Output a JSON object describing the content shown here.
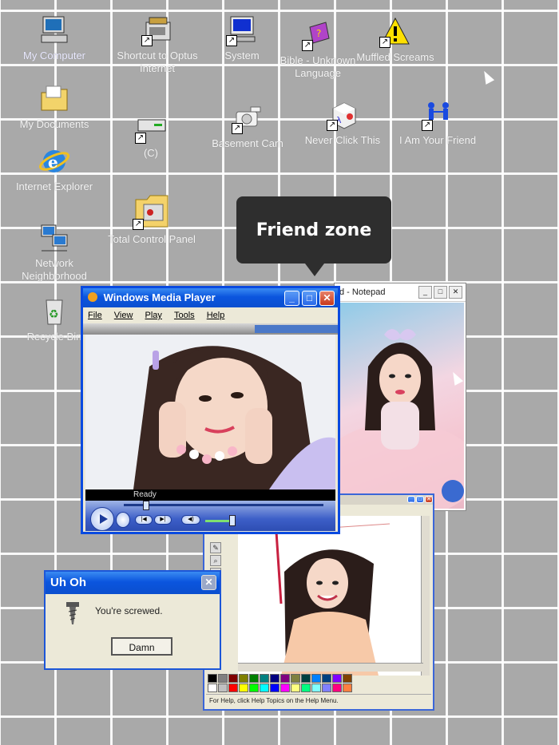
{
  "desktop": {
    "icons": [
      {
        "label": "My Computer",
        "icon": "computer-icon"
      },
      {
        "label": "Shortcut to Optus Internet",
        "icon": "phone-icon"
      },
      {
        "label": "System",
        "icon": "monitor-icon"
      },
      {
        "label": "Bible - Unknown Language",
        "icon": "book-icon"
      },
      {
        "label": "Muffled Screams",
        "icon": "warning-icon"
      },
      {
        "label": "My Documents",
        "icon": "folder-icon"
      },
      {
        "label": "(C)",
        "icon": "drive-icon"
      },
      {
        "label": "Basement Cam",
        "icon": "camera-icon"
      },
      {
        "label": "Never Click This",
        "icon": "cube-icon"
      },
      {
        "label": "I Am Your Friend",
        "icon": "people-icon"
      },
      {
        "label": "Internet Explorer",
        "icon": "ie-icon"
      },
      {
        "label": "Total Control Panel",
        "icon": "control-panel-icon"
      },
      {
        "label": "Network Neighborhood",
        "icon": "network-icon"
      },
      {
        "label": "Recycle Bin",
        "icon": "recycle-icon"
      }
    ],
    "tooltip": "Friend zone"
  },
  "notepad": {
    "title": "d - Notepad"
  },
  "wmp": {
    "title": "Windows Media Player",
    "menu": [
      "File",
      "View",
      "Play",
      "Tools",
      "Help"
    ],
    "status": "Ready"
  },
  "paint": {
    "status": "For Help, click Help Topics on the Help Menu.",
    "palette": [
      "#000000",
      "#808080",
      "#800000",
      "#808000",
      "#008000",
      "#008080",
      "#000080",
      "#800080",
      "#808040",
      "#004040",
      "#0080ff",
      "#004080",
      "#8000ff",
      "#804000",
      "#ffffff",
      "#c0c0c0",
      "#ff0000",
      "#ffff00",
      "#00ff00",
      "#00ffff",
      "#0000ff",
      "#ff00ff",
      "#ffff80",
      "#00ff80",
      "#80ffff",
      "#8080ff",
      "#ff0080",
      "#ff8040"
    ]
  },
  "dialog": {
    "title": "Uh Oh",
    "message": "You're screwed.",
    "button": "Damn"
  },
  "colors": {
    "xp_blue": "#0b55de",
    "grid_bg": "#a9a9a9",
    "tooltip_bg": "#2e2e2e"
  }
}
